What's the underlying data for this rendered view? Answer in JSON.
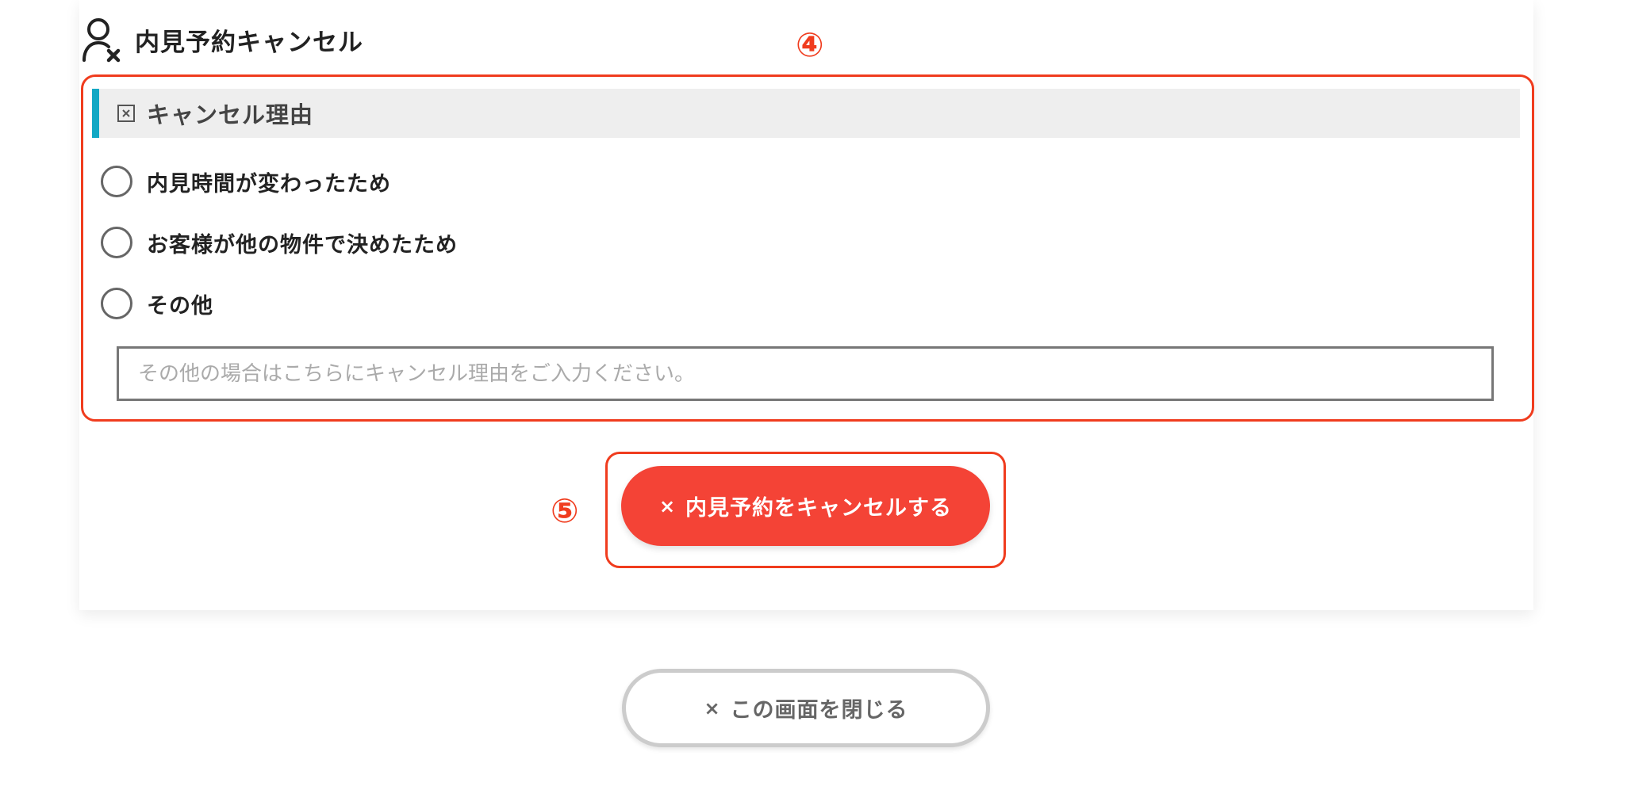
{
  "heading": {
    "title": "内見予約キャンセル",
    "icon": "user-remove-icon"
  },
  "annotations": {
    "reason_section_marker": "④",
    "cancel_button_marker": "⑤",
    "color": "#f03c1e"
  },
  "reason_section": {
    "title": "キャンセル理由",
    "icon": "box-x-icon",
    "accent_color": "#12a8c4",
    "options": [
      {
        "label": "内見時間が変わったため",
        "selected": false
      },
      {
        "label": "お客様が他の物件で決めたため",
        "selected": false
      },
      {
        "label": "その他",
        "selected": false
      }
    ],
    "other_input": {
      "value": "",
      "placeholder": "その他の場合はこちらにキャンセル理由をご入力ください。"
    }
  },
  "cancel_button": {
    "icon": "×",
    "label": "内見予約をキャンセルする",
    "color": "#f44336"
  },
  "close_button": {
    "icon": "×",
    "label": "この画面を閉じる"
  }
}
